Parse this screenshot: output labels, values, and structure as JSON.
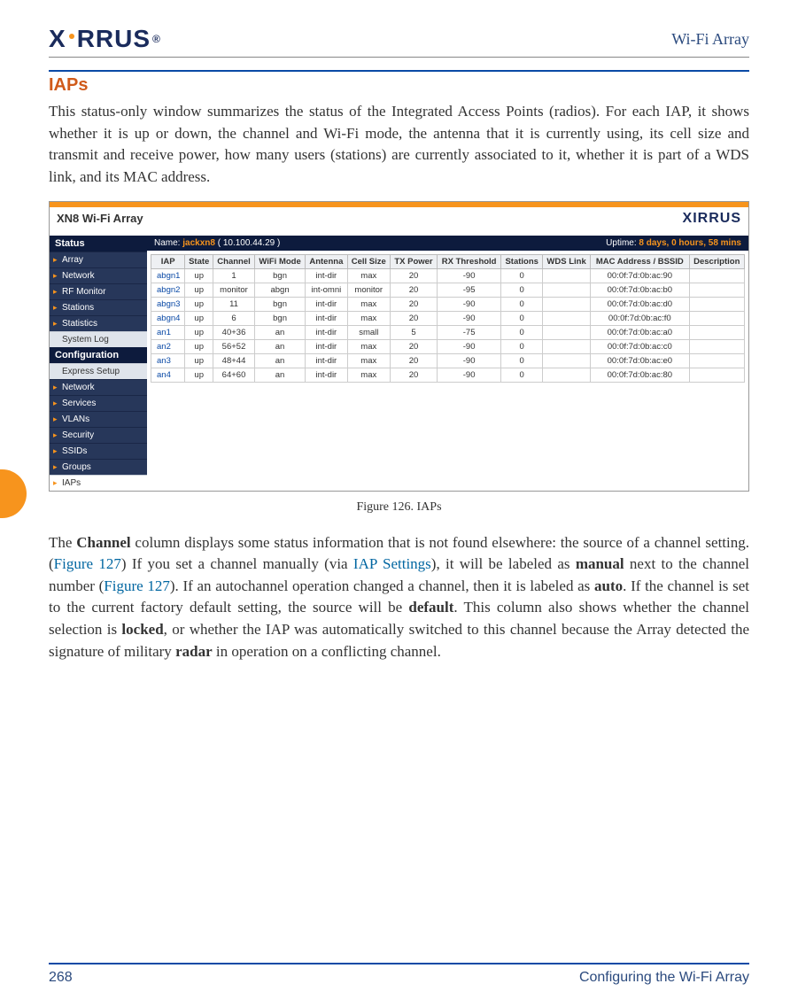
{
  "header": {
    "brand": "XIRRUS",
    "doc_title": "Wi-Fi Array"
  },
  "section_title": "IAPs",
  "intro": "This status-only window summarizes the status of the Integrated Access Points (radios). For each IAP, it shows whether it is up or down, the channel and Wi-Fi mode, the antenna that it is currently using, its cell size and transmit and receive power, how many users (stations) are currently associated to it, whether it is part of a WDS link, and its MAC address.",
  "figure": {
    "caption": "Figure 126. IAPs",
    "window_title": "XN8 Wi-Fi Array",
    "small_logo": "XIRRUS",
    "name_label": "Name: ",
    "name_value": "jackxn8",
    "name_ip": " ( 10.100.44.29 )",
    "uptime_label": "Uptime: ",
    "uptime_value": "8 days, 0 hours, 58 mins",
    "sidebar": {
      "status_head": "Status",
      "config_head": "Configuration",
      "status_items": [
        "Array",
        "Network",
        "RF Monitor",
        "Stations",
        "Statistics"
      ],
      "status_sub": "System Log",
      "config_sub": "Express Setup",
      "config_items": [
        "Network",
        "Services",
        "VLANs",
        "Security",
        "SSIDs",
        "Groups"
      ],
      "active": "IAPs"
    },
    "columns": [
      "IAP",
      "State",
      "Channel",
      "WiFi Mode",
      "Antenna",
      "Cell Size",
      "TX Power",
      "RX Threshold",
      "Stations",
      "WDS Link",
      "MAC Address / BSSID",
      "Description"
    ],
    "rows": [
      {
        "iap": "abgn1",
        "state": "up",
        "ch": "1",
        "mode": "bgn",
        "ant": "int-dir",
        "cell": "max",
        "tx": "20",
        "rx": "-90",
        "sta": "0",
        "wds": "",
        "mac": "00:0f:7d:0b:ac:90",
        "desc": ""
      },
      {
        "iap": "abgn2",
        "state": "up",
        "ch": "monitor",
        "mode": "abgn",
        "ant": "int-omni",
        "cell": "monitor",
        "tx": "20",
        "rx": "-95",
        "sta": "0",
        "wds": "",
        "mac": "00:0f:7d:0b:ac:b0",
        "desc": ""
      },
      {
        "iap": "abgn3",
        "state": "up",
        "ch": "11",
        "mode": "bgn",
        "ant": "int-dir",
        "cell": "max",
        "tx": "20",
        "rx": "-90",
        "sta": "0",
        "wds": "",
        "mac": "00:0f:7d:0b:ac:d0",
        "desc": ""
      },
      {
        "iap": "abgn4",
        "state": "up",
        "ch": "6",
        "mode": "bgn",
        "ant": "int-dir",
        "cell": "max",
        "tx": "20",
        "rx": "-90",
        "sta": "0",
        "wds": "",
        "mac": "00:0f:7d:0b:ac:f0",
        "desc": ""
      },
      {
        "iap": "an1",
        "state": "up",
        "ch": "40+36",
        "mode": "an",
        "ant": "int-dir",
        "cell": "small",
        "tx": "5",
        "rx": "-75",
        "sta": "0",
        "wds": "",
        "mac": "00:0f:7d:0b:ac:a0",
        "desc": ""
      },
      {
        "iap": "an2",
        "state": "up",
        "ch": "56+52",
        "mode": "an",
        "ant": "int-dir",
        "cell": "max",
        "tx": "20",
        "rx": "-90",
        "sta": "0",
        "wds": "",
        "mac": "00:0f:7d:0b:ac:c0",
        "desc": ""
      },
      {
        "iap": "an3",
        "state": "up",
        "ch": "48+44",
        "mode": "an",
        "ant": "int-dir",
        "cell": "max",
        "tx": "20",
        "rx": "-90",
        "sta": "0",
        "wds": "",
        "mac": "00:0f:7d:0b:ac:e0",
        "desc": ""
      },
      {
        "iap": "an4",
        "state": "up",
        "ch": "64+60",
        "mode": "an",
        "ant": "int-dir",
        "cell": "max",
        "tx": "20",
        "rx": "-90",
        "sta": "0",
        "wds": "",
        "mac": "00:0f:7d:0b:ac:80",
        "desc": ""
      }
    ]
  },
  "para2": {
    "t1": "The ",
    "b1": "Channel",
    "t2": " column displays some status information that is not found elsewhere: the source of a channel setting. (",
    "l1": "Figure 127",
    "t3": ") If you set a channel manually (via ",
    "l2": "IAP Settings",
    "t4": "), it will be labeled as ",
    "b2": "manual",
    "t5": " next to the channel number (",
    "l3": "Figure 127",
    "t6": "). If an autochannel operation changed a channel, then it is labeled as ",
    "b3": "auto",
    "t7": ". If the channel is set to the current factory default setting, the source will be ",
    "b4": "default",
    "t8": ". This column also shows whether the channel selection is ",
    "b5": "locked",
    "t9": ", or whether the IAP was automatically switched to this channel because the Array detected the signature of military ",
    "b6": "radar",
    "t10": " in operation on a conflicting channel."
  },
  "footer": {
    "page": "268",
    "section": "Configuring the Wi-Fi Array"
  }
}
